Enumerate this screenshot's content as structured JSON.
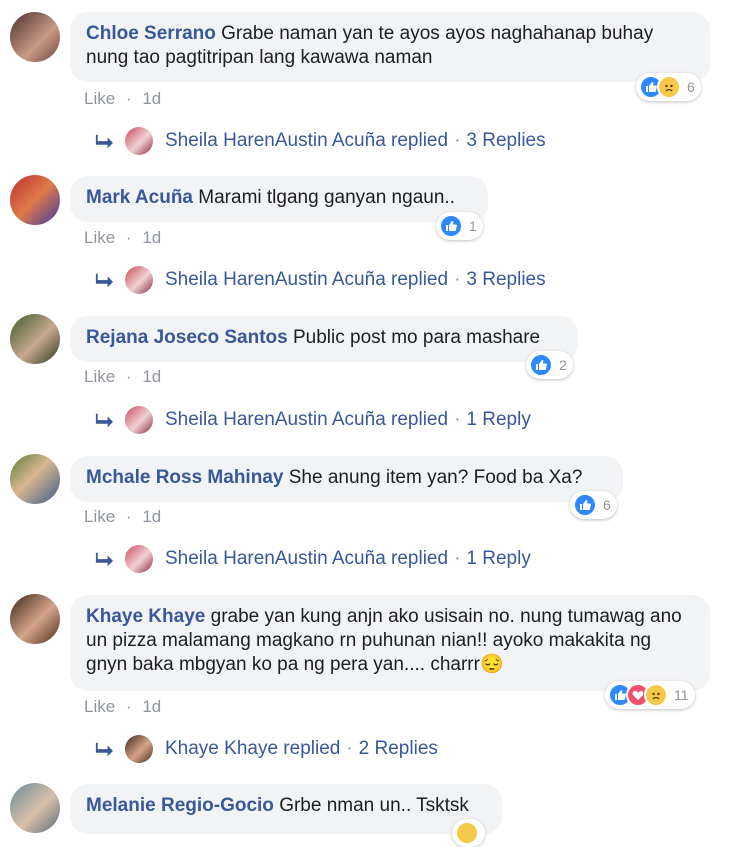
{
  "comments": [
    {
      "author": "Chloe Serrano",
      "text": "Grabe naman yan te ayos ayos naghahanap buhay nung tao pagtitripan lang kawawa naman",
      "like": "Like",
      "sep": "·",
      "time": "1d",
      "reaction_count": "6",
      "reactions": [
        "like-icon",
        "sad-icon"
      ],
      "reply_author": "Sheila HarenAustin Acuña replied",
      "reply_count": "3 Replies"
    },
    {
      "author": "Mark Acuña",
      "text": "Marami tlgang ganyan ngaun..",
      "like": "Like",
      "sep": "·",
      "time": "1d",
      "reaction_count": "1",
      "reactions": [
        "like-icon"
      ],
      "reply_author": "Sheila HarenAustin Acuña replied",
      "reply_count": "3 Replies"
    },
    {
      "author": "Rejana Joseco Santos",
      "text": "Public post mo para mashare",
      "like": "Like",
      "sep": "·",
      "time": "1d",
      "reaction_count": "2",
      "reactions": [
        "like-icon"
      ],
      "reply_author": "Sheila HarenAustin Acuña replied",
      "reply_count": "1 Reply"
    },
    {
      "author": "Mchale Ross Mahinay",
      "text": "She anung item yan? Food ba Xa?",
      "like": "Like",
      "sep": "·",
      "time": "1d",
      "reaction_count": "6",
      "reactions": [
        "like-icon"
      ],
      "reply_author": "Sheila HarenAustin Acuña replied",
      "reply_count": "1 Reply"
    },
    {
      "author": "Khaye Khaye",
      "text": "grabe yan kung anjn ako usisain no. nung tumawag ano un pizza malamang magkano rn puhunan nian!! ayoko makakita ng gnyn baka mbgyan ko pa ng pera yan.... charrr😔",
      "like": "Like",
      "sep": "·",
      "time": "1d",
      "reaction_count": "11",
      "reactions": [
        "like-icon",
        "love-icon",
        "sad-icon"
      ],
      "reply_author": "Khaye Khaye replied",
      "reply_count": "2 Replies"
    },
    {
      "author": "Melanie Regio-Gocio",
      "text": "Grbe nman un.. Tsktsk"
    }
  ],
  "colors": {
    "link": "#385898",
    "bubble": "#f2f3f5",
    "meta": "#90949c",
    "like": "#2e89ff",
    "love": "#f0506e",
    "sad": "#f7c94a"
  }
}
